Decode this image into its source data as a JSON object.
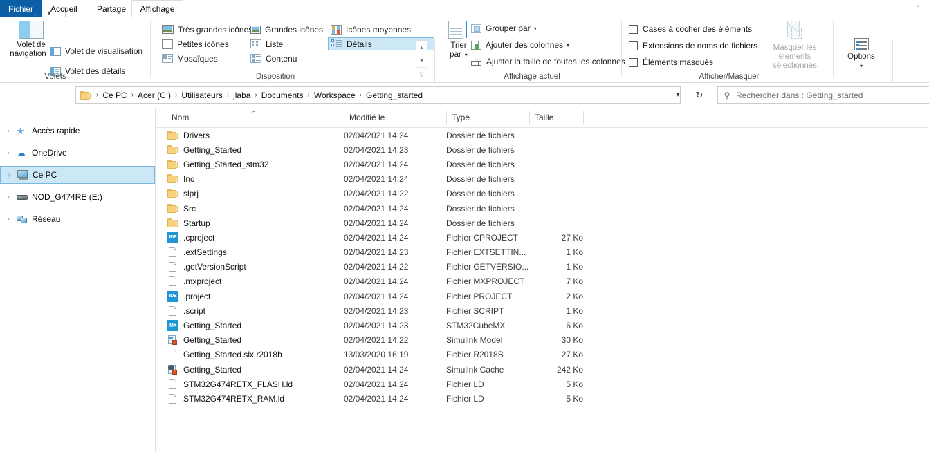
{
  "window": {
    "ribbon_collapse_icon": "chevron-up-icon"
  },
  "tabs": [
    {
      "label": "Fichier",
      "active": false,
      "kind": "file"
    },
    {
      "label": "Accueil",
      "active": false,
      "kind": "normal"
    },
    {
      "label": "Partage",
      "active": false,
      "kind": "normal"
    },
    {
      "label": "Affichage",
      "active": true,
      "kind": "normal"
    }
  ],
  "ribbon": {
    "groups": [
      {
        "name": "Volets"
      },
      {
        "name": "Disposition"
      },
      {
        "name": "Affichage actuel"
      },
      {
        "name": "Afficher/Masquer"
      }
    ],
    "volets": {
      "nav_pane_line1": "Volet de",
      "nav_pane_line2": "navigation",
      "nav_pane_caret": "▾",
      "preview_pane": "Volet de visualisation",
      "details_pane": "Volet des détails"
    },
    "disposition": {
      "items": [
        {
          "label": "Très grandes icônes",
          "selected": false
        },
        {
          "label": "Grandes icônes",
          "selected": false
        },
        {
          "label": "Icônes moyennes",
          "selected": false
        },
        {
          "label": "Petites icônes",
          "selected": false
        },
        {
          "label": "Liste",
          "selected": false
        },
        {
          "label": "Détails",
          "selected": true
        },
        {
          "label": "Mosaïques",
          "selected": false
        },
        {
          "label": "Contenu",
          "selected": false
        }
      ],
      "scroll_up": "▴",
      "scroll_down": "▾",
      "scroll_more": "▾"
    },
    "affichage_actuel": {
      "sort_line1": "Trier",
      "sort_line2": "par",
      "sort_caret": "▾",
      "group_by": "Grouper par",
      "group_by_caret": "▾",
      "add_columns": "Ajouter des colonnes",
      "add_columns_caret": "▾",
      "fit_columns": "Ajuster la taille de toutes les colonnes"
    },
    "afficher_masquer": {
      "item_checkboxes": "Cases à cocher des éléments",
      "file_extensions": "Extensions de noms de fichiers",
      "hidden_items": "Éléments masqués",
      "hide_selected_line1": "Masquer les éléments",
      "hide_selected_line2": "sélectionnés",
      "options": "Options",
      "options_caret": "▾"
    }
  },
  "addressbar": {
    "back_icon": "arrow-left-icon",
    "forward_icon": "arrow-right-icon",
    "recent_icon": "chevron-down-icon",
    "up_icon": "arrow-up-icon",
    "dropdown_icon": "chevron-down-icon",
    "refresh_icon": "refresh-icon",
    "separator": "›",
    "crumbs": [
      "Ce PC",
      "Acer (C:)",
      "Utilisateurs",
      "jlaba",
      "Documents",
      "Workspace",
      "Getting_started"
    ],
    "search_placeholder": "Rechercher dans : Getting_started",
    "search_value": "",
    "search_icon": "search-icon"
  },
  "sidebar": {
    "items": [
      {
        "label": "Accès rapide",
        "icon": "star-icon",
        "expander": "›",
        "selected": false
      },
      {
        "label": "OneDrive",
        "icon": "cloud-icon",
        "expander": "›",
        "selected": false
      },
      {
        "label": "Ce PC",
        "icon": "computer-icon",
        "expander": "›",
        "selected": true
      },
      {
        "label": "NOD_G474RE (E:)",
        "icon": "drive-icon",
        "expander": "›",
        "selected": false
      },
      {
        "label": "Réseau",
        "icon": "network-icon",
        "expander": "›",
        "selected": false
      }
    ]
  },
  "filelist": {
    "columns": [
      {
        "key": "name",
        "label": "Nom",
        "sorted": true,
        "sort_caret": "⌃"
      },
      {
        "key": "date",
        "label": "Modifié le",
        "sorted": false
      },
      {
        "key": "type",
        "label": "Type",
        "sorted": false
      },
      {
        "key": "size",
        "label": "Taille",
        "sorted": false
      }
    ],
    "rows": [
      {
        "name": "Drivers",
        "date": "02/04/2021 14:24",
        "type": "Dossier de fichiers",
        "size": "",
        "icon": "folder-icon"
      },
      {
        "name": "Getting_Started",
        "date": "02/04/2021 14:23",
        "type": "Dossier de fichiers",
        "size": "",
        "icon": "folder-icon"
      },
      {
        "name": "Getting_Started_stm32",
        "date": "02/04/2021 14:24",
        "type": "Dossier de fichiers",
        "size": "",
        "icon": "folder-icon"
      },
      {
        "name": "Inc",
        "date": "02/04/2021 14:24",
        "type": "Dossier de fichiers",
        "size": "",
        "icon": "folder-icon"
      },
      {
        "name": "slprj",
        "date": "02/04/2021 14:22",
        "type": "Dossier de fichiers",
        "size": "",
        "icon": "folder-icon"
      },
      {
        "name": "Src",
        "date": "02/04/2021 14:24",
        "type": "Dossier de fichiers",
        "size": "",
        "icon": "folder-icon"
      },
      {
        "name": "Startup",
        "date": "02/04/2021 14:24",
        "type": "Dossier de fichiers",
        "size": "",
        "icon": "folder-icon"
      },
      {
        "name": ".cproject",
        "date": "02/04/2021 14:24",
        "type": "Fichier CPROJECT",
        "size": "27 Ko",
        "icon": "ide-file-icon"
      },
      {
        "name": ".extSettings",
        "date": "02/04/2021 14:23",
        "type": "Fichier EXTSETTIN...",
        "size": "1 Ko",
        "icon": "generic-file-icon"
      },
      {
        "name": ".getVersionScript",
        "date": "02/04/2021 14:22",
        "type": "Fichier GETVERSIO...",
        "size": "1 Ko",
        "icon": "generic-file-icon"
      },
      {
        "name": ".mxproject",
        "date": "02/04/2021 14:24",
        "type": "Fichier MXPROJECT",
        "size": "7 Ko",
        "icon": "generic-file-icon"
      },
      {
        "name": ".project",
        "date": "02/04/2021 14:24",
        "type": "Fichier PROJECT",
        "size": "2 Ko",
        "icon": "ide-file-icon"
      },
      {
        "name": ".script",
        "date": "02/04/2021 14:23",
        "type": "Fichier SCRIPT",
        "size": "1 Ko",
        "icon": "generic-file-icon"
      },
      {
        "name": "Getting_Started",
        "date": "02/04/2021 14:23",
        "type": "STM32CubeMX",
        "size": "6 Ko",
        "icon": "mx-file-icon"
      },
      {
        "name": "Getting_Started",
        "date": "02/04/2021 14:22",
        "type": "Simulink Model",
        "size": "30 Ko",
        "icon": "simulink-model-icon"
      },
      {
        "name": "Getting_Started.slx.r2018b",
        "date": "13/03/2020 16:19",
        "type": "Fichier R2018B",
        "size": "27 Ko",
        "icon": "generic-file-icon"
      },
      {
        "name": "Getting_Started",
        "date": "02/04/2021 14:24",
        "type": "Simulink Cache",
        "size": "242 Ko",
        "icon": "simulink-cache-icon"
      },
      {
        "name": "STM32G474RETX_FLASH.ld",
        "date": "02/04/2021 14:24",
        "type": "Fichier LD",
        "size": "5 Ko",
        "icon": "generic-file-icon"
      },
      {
        "name": "STM32G474RETX_RAM.ld",
        "date": "02/04/2021 14:24",
        "type": "Fichier LD",
        "size": "5 Ko",
        "icon": "generic-file-icon"
      }
    ]
  },
  "colors": {
    "file_tab_blue": "#0b5fa5",
    "selection_fill": "#cce8f7",
    "selection_border": "#79b9e0",
    "folder_yellow": "#f6d27e",
    "ide_badge_blue": "#2196d6"
  }
}
